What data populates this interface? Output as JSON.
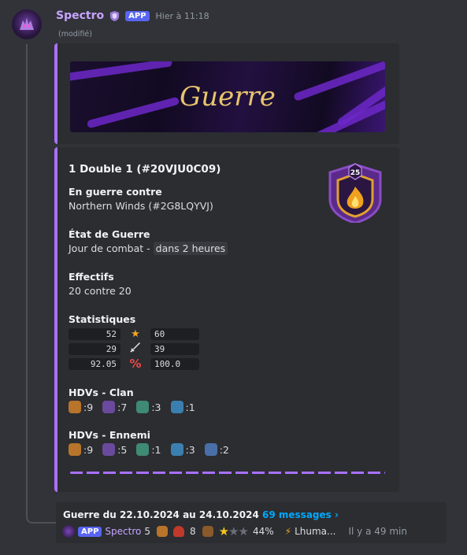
{
  "message": {
    "username": "Spectro",
    "app_tag": "APP",
    "timestamp": "Hier à 11:18",
    "edited": "(modifié)"
  },
  "banner": {
    "title": "Guerre"
  },
  "embed": {
    "title": "1 Double 1 (#20VJU0C09)",
    "clan_level": "25",
    "fields": {
      "opponent_label": "En guerre contre",
      "opponent_value": "Northern Winds (#2G8LQYVJ)",
      "state_label": "État de Guerre",
      "state_value": "Jour de combat -",
      "state_time": "dans 2 heures",
      "size_label": "Effectifs",
      "size_value": "20 contre 20",
      "stats_label": "Statistiques",
      "hdv_clan_label": "HDVs - Clan",
      "hdv_enemy_label": "HDVs - Ennemi"
    },
    "stats": [
      {
        "left": "52",
        "icon": "star-icon",
        "right": "60"
      },
      {
        "left": "29",
        "icon": "sword-icon",
        "right": "39"
      },
      {
        "left": "92.05",
        "icon": "percent-icon",
        "right": "100.0"
      }
    ],
    "hdv_clan": [
      {
        "icon": "town-hall-17-icon",
        "count": ":9",
        "color": "#b8742a"
      },
      {
        "icon": "town-hall-16-icon",
        "count": ":7",
        "color": "#6a4a9c"
      },
      {
        "icon": "town-hall-15-icon",
        "count": ":3",
        "color": "#3f8a72"
      },
      {
        "icon": "town-hall-14-icon",
        "count": ":1",
        "color": "#3b7fb0"
      }
    ],
    "hdv_enemy": [
      {
        "icon": "town-hall-17-icon",
        "count": ":9",
        "color": "#b8742a"
      },
      {
        "icon": "town-hall-16-icon",
        "count": ":5",
        "color": "#6a4a9c"
      },
      {
        "icon": "town-hall-15-icon",
        "count": ":1",
        "color": "#3f8a72"
      },
      {
        "icon": "town-hall-14-icon",
        "count": ":3",
        "color": "#3b7fb0"
      },
      {
        "icon": "town-hall-13-icon",
        "count": ":2",
        "color": "#4a6fa8"
      }
    ]
  },
  "thread": {
    "title": "Guerre du 22.10.2024 au 24.10.2024",
    "messages_link": "69 messages ›",
    "app_tag": "APP",
    "username": "Spectro",
    "count_a": "5",
    "count_b": "8",
    "percent": "44%",
    "last_user": "Lhuma...",
    "time_ago": "Il y a 49 min",
    "stars_filled": 1,
    "stars_total": 3
  },
  "colors": {
    "accent": "#a970ff",
    "link": "#00a8fc",
    "background": "#313338",
    "embed": "#2b2d31"
  }
}
